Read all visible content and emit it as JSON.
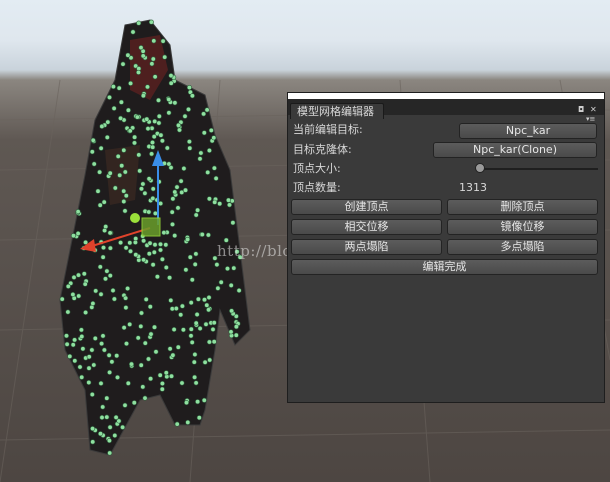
{
  "window": {
    "tab_title": "模型网格编辑器",
    "menu_icon": "tab-menu-icon",
    "maximize_icon": "maximize-icon",
    "close_icon": "close-icon"
  },
  "fields": {
    "target_label": "当前编辑目标:",
    "target_value": "Npc_kar",
    "clone_label": "目标克隆体:",
    "clone_value": "Npc_kar(Clone)",
    "vertex_size_label": "顶点大小:",
    "vertex_size_value": 0.0,
    "vertex_count_label": "顶点数量:",
    "vertex_count_value": "1313"
  },
  "buttons": {
    "create_vertex": "创建顶点",
    "delete_vertex": "删除顶点",
    "intersect_move": "相交位移",
    "mirror_move": "镜像位移",
    "two_point_collapse": "两点塌陷",
    "multi_point_collapse": "多点塌陷",
    "finish_edit": "编辑完成"
  },
  "watermark": "http://blog.csdn.net/",
  "colors": {
    "panel_bg": "#3a3a3a",
    "vertex_point": "#8fe0a0",
    "gizmo_x": "#e0432b",
    "gizmo_y": "#3a8ee8",
    "gizmo_center": "#9be03a"
  }
}
